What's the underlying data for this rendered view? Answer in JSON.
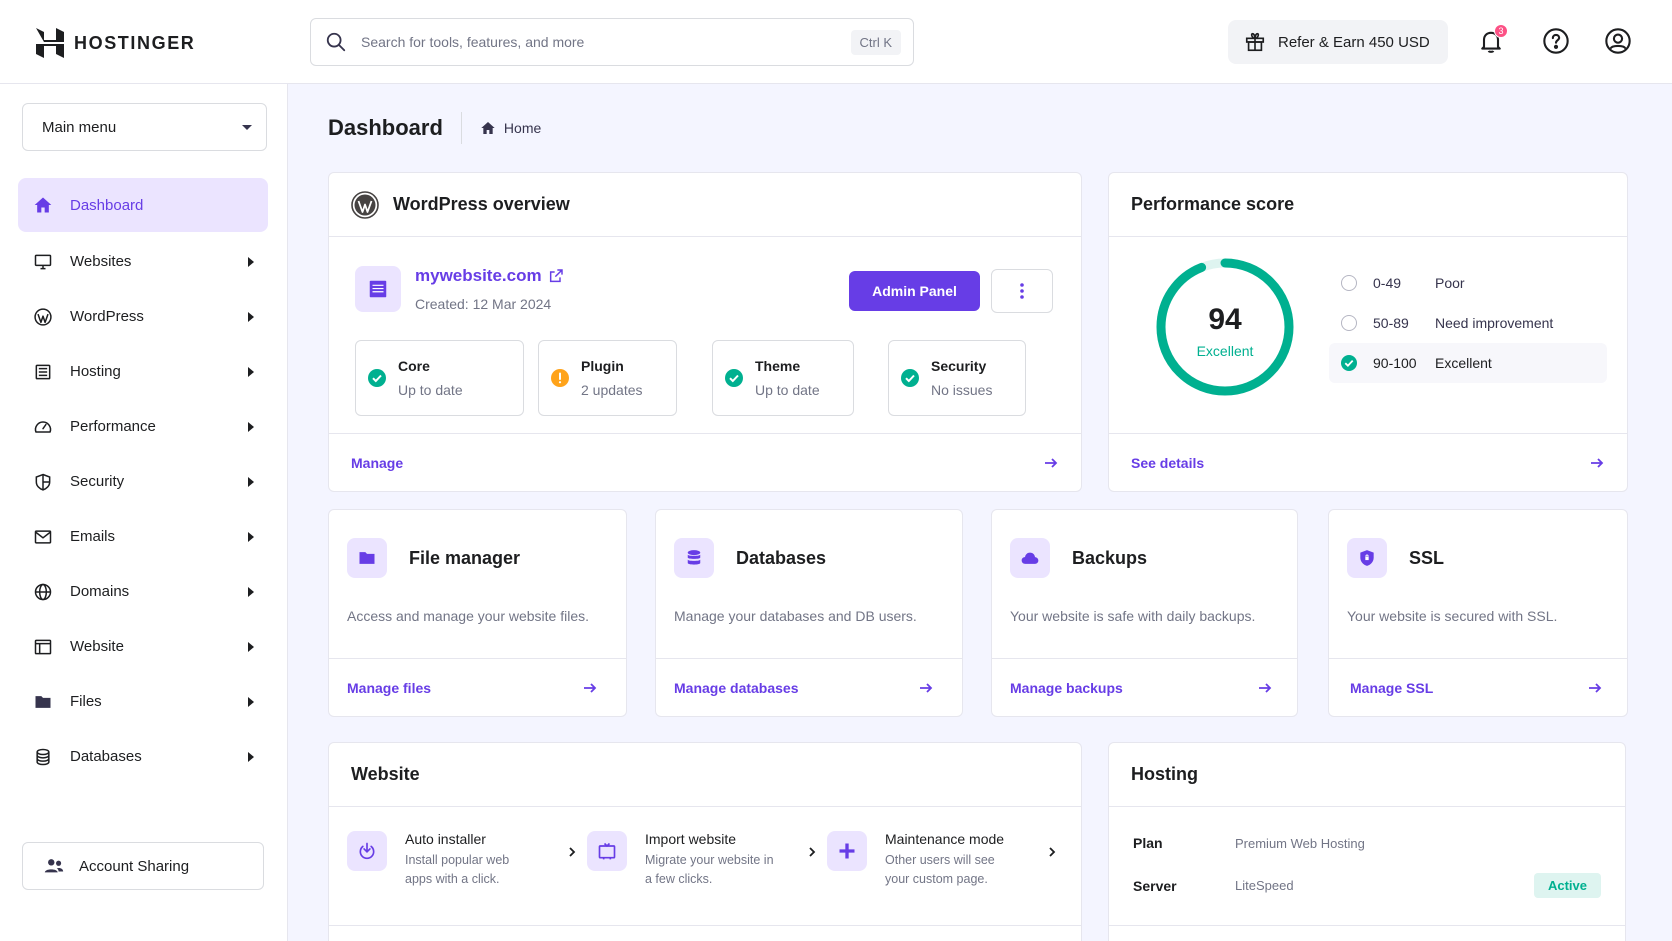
{
  "brand": {
    "name": "HOSTINGER"
  },
  "search": {
    "placeholder": "Search for tools, features, and more",
    "shortcut": "Ctrl K"
  },
  "header": {
    "refer_label": "Refer & Earn 450 USD",
    "notifications_count": "3"
  },
  "sidebar": {
    "menu_select": "Main menu",
    "items": [
      {
        "label": "Dashboard",
        "icon": "home-icon",
        "active": true
      },
      {
        "label": "Websites",
        "icon": "monitor-icon"
      },
      {
        "label": "WordPress",
        "icon": "wordpress-icon"
      },
      {
        "label": "Hosting",
        "icon": "server-icon"
      },
      {
        "label": "Performance",
        "icon": "speedometer-icon"
      },
      {
        "label": "Security",
        "icon": "shield-icon"
      },
      {
        "label": "Emails",
        "icon": "mail-icon"
      },
      {
        "label": "Domains",
        "icon": "globe-icon"
      },
      {
        "label": "Website",
        "icon": "browser-icon"
      },
      {
        "label": "Files",
        "icon": "folder-icon"
      },
      {
        "label": "Databases",
        "icon": "database-icon"
      }
    ],
    "account_sharing": "Account Sharing"
  },
  "page": {
    "title": "Dashboard",
    "breadcrumb": "Home"
  },
  "wordpress": {
    "title": "WordPress overview",
    "site": "mywebsite.com",
    "created": "Created: 12 Mar 2024",
    "admin_button": "Admin Panel",
    "statuses": [
      {
        "title": "Core",
        "sub": "Up to date",
        "state": "ok"
      },
      {
        "title": "Plugin",
        "sub": "2 updates",
        "state": "warn"
      },
      {
        "title": "Theme",
        "sub": "Up to date",
        "state": "ok"
      },
      {
        "title": "Security",
        "sub": "No issues",
        "state": "ok"
      }
    ],
    "footer_link": "Manage"
  },
  "performance": {
    "title": "Performance score",
    "score": "94",
    "score_value": 94,
    "rating": "Excellent",
    "legend": [
      {
        "range": "0-49",
        "label": "Poor"
      },
      {
        "range": "50-89",
        "label": "Need improvement"
      },
      {
        "range": "90-100",
        "label": "Excellent"
      }
    ],
    "footer_link": "See details"
  },
  "tools": [
    {
      "title": "File manager",
      "desc": "Access and manage your website files.",
      "link": "Manage files",
      "icon": "folder-icon"
    },
    {
      "title": "Databases",
      "desc": "Manage your databases and DB users.",
      "link": "Manage databases",
      "icon": "database-icon"
    },
    {
      "title": "Backups",
      "desc": "Your website is safe with daily backups.",
      "link": "Manage backups",
      "icon": "cloud-icon"
    },
    {
      "title": "SSL",
      "desc": "Your website is secured with SSL.",
      "link": "Manage SSL",
      "icon": "shield-lock-icon"
    }
  ],
  "website": {
    "title": "Website",
    "features": [
      {
        "title": "Auto installer",
        "sub": "Install popular web apps with a click.",
        "icon": "installer-icon"
      },
      {
        "title": "Import website",
        "sub": "Migrate your website in a few clicks.",
        "icon": "import-icon"
      },
      {
        "title": "Maintenance mode",
        "sub": "Other users will see your custom page.",
        "icon": "maintenance-icon"
      }
    ]
  },
  "hosting": {
    "title": "Hosting",
    "plan_label": "Plan",
    "plan_value": "Premium Web Hosting",
    "server_label": "Server",
    "server_value": "LiteSpeed",
    "server_status": "Active"
  },
  "colors": {
    "accent": "#673de6",
    "success": "#00b090",
    "warning": "#ffa31a",
    "danger": "#fc5185"
  }
}
